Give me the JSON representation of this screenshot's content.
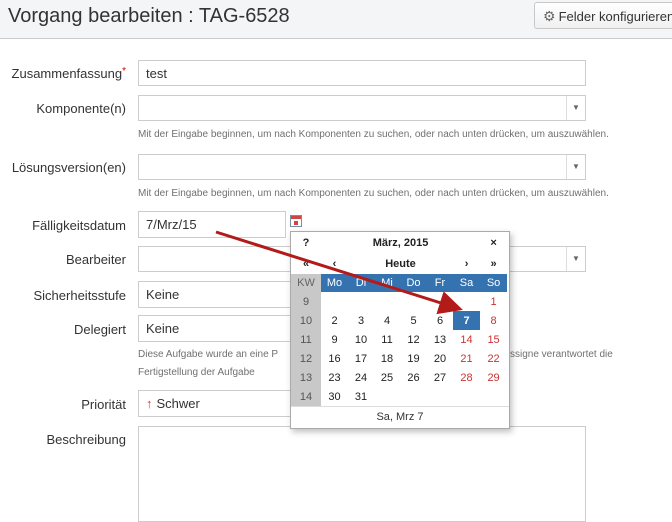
{
  "header": {
    "title": "Vorgang bearbeiten : TAG-6528",
    "configure_button": "Felder konfigurieren"
  },
  "form": {
    "summary": {
      "label": "Zusammenfassung",
      "required_marker": "*",
      "value": "test"
    },
    "components": {
      "label": "Komponente(n)",
      "help": "Mit der Eingabe beginnen, um nach Komponenten zu suchen, oder nach unten drücken, um auszuwählen."
    },
    "fix_versions": {
      "label": "Lösungsversion(en)",
      "help": "Mit der Eingabe beginnen, um nach Komponenten zu suchen, oder nach unten drücken, um auszuwählen."
    },
    "due_date": {
      "label": "Fälligkeitsdatum",
      "value": "7/Mrz/15"
    },
    "assignee": {
      "label": "Bearbeiter"
    },
    "security": {
      "label": "Sicherheitsstufe",
      "value": "Keine"
    },
    "delegated": {
      "label": "Delegiert",
      "value": "Keine",
      "help_left_1": "Diese Aufgabe wurde an eine P",
      "help_right_1": "ssigne verantwortet die",
      "help_line_2": "Fertigstellung der Aufgabe"
    },
    "priority": {
      "label": "Priorität",
      "value": "Schwer",
      "icon": "arrow-up-icon",
      "color": "#d04437"
    },
    "description": {
      "label": "Beschreibung"
    }
  },
  "calendar": {
    "help": "?",
    "month_title": "März, 2015",
    "close": "×",
    "prev_year": "«",
    "prev_month": "‹",
    "today": "Heute",
    "next_month": "›",
    "next_year": "»",
    "kw_label": "KW",
    "weekdays": [
      "Mo",
      "Di",
      "Mi",
      "Do",
      "Fr",
      "Sa",
      "So"
    ],
    "weeks": [
      {
        "kw": "9",
        "days": [
          "",
          "",
          "",
          "",
          "",
          "",
          "1"
        ]
      },
      {
        "kw": "10",
        "days": [
          "2",
          "3",
          "4",
          "5",
          "6",
          "7",
          "8"
        ]
      },
      {
        "kw": "11",
        "days": [
          "9",
          "10",
          "11",
          "12",
          "13",
          "14",
          "15"
        ]
      },
      {
        "kw": "12",
        "days": [
          "16",
          "17",
          "18",
          "19",
          "20",
          "21",
          "22"
        ]
      },
      {
        "kw": "13",
        "days": [
          "23",
          "24",
          "25",
          "26",
          "27",
          "28",
          "29"
        ]
      },
      {
        "kw": "14",
        "days": [
          "30",
          "31",
          "",
          "",
          "",
          "",
          ""
        ]
      }
    ],
    "selected_day": "7",
    "footer": "Sa, Mrz 7",
    "accent_color": "#3572b0",
    "weekend_color": "#cc3333"
  },
  "annotation": {
    "color": "#b31b1b"
  }
}
